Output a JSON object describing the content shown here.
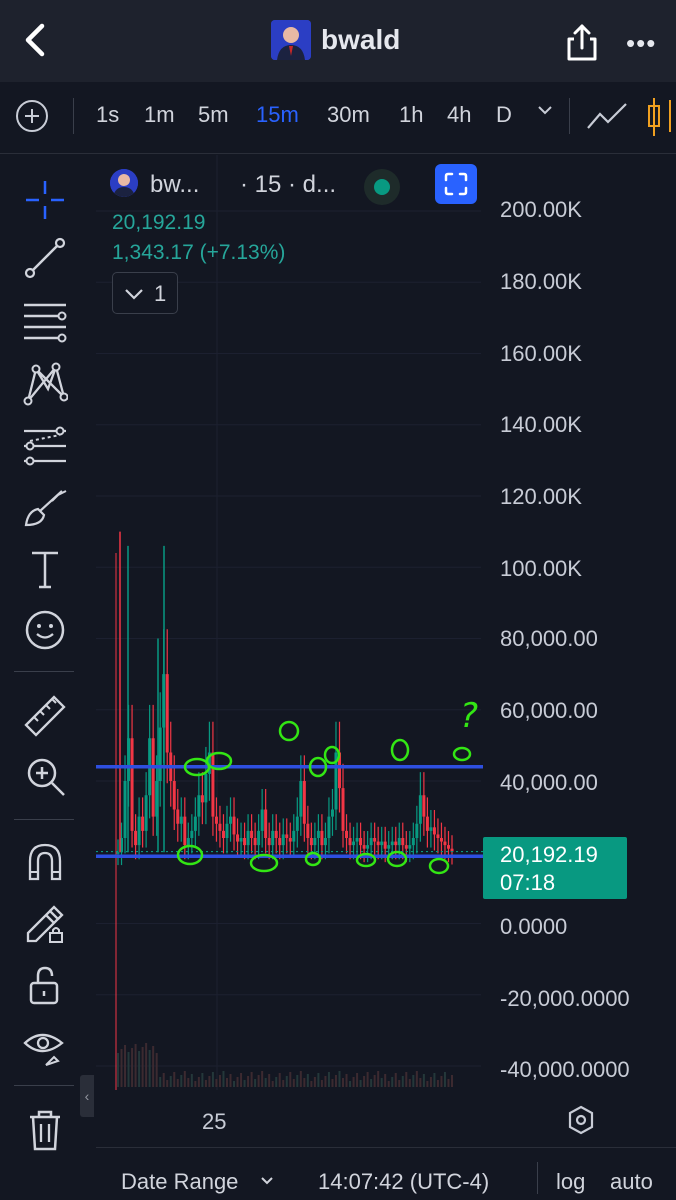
{
  "header": {
    "title": "bwald",
    "back_icon": "chevron-left-icon",
    "share_icon": "share-icon",
    "more_label": "•••"
  },
  "intervals": [
    {
      "label": "1s",
      "active": false
    },
    {
      "label": "1m",
      "active": false
    },
    {
      "label": "5m",
      "active": false
    },
    {
      "label": "15m",
      "active": true
    },
    {
      "label": "30m",
      "active": false
    },
    {
      "label": "1h",
      "active": false
    },
    {
      "label": "4h",
      "active": false
    },
    {
      "label": "D",
      "active": false
    }
  ],
  "interval_dropdown": "⌄",
  "toolbar_icons": [
    "crosshair-icon",
    "trend-line-icon",
    "fib-lines-icon",
    "pattern-icon",
    "projection-icon",
    "brush-icon",
    "text-icon",
    "emoji-icon",
    "ruler-icon",
    "zoom-in-icon",
    "magnet-icon",
    "lock-draw-icon",
    "unlock-icon",
    "eye-icon",
    "trash-icon"
  ],
  "legend": {
    "symbol": "bw...",
    "resolution": "· 15 · d...",
    "price": "20,192.19",
    "change": "1,343.17 (+7.13%)",
    "layer_count": "1"
  },
  "yaxis_labels": [
    "200.00K",
    "180.00K",
    "160.00K",
    "140.00K",
    "120.00K",
    "100.00K",
    "80,000.00",
    "60,000.00",
    "40,000.00",
    "0.0000",
    "-20,000.0000",
    "-40,000.0000"
  ],
  "price_tag": {
    "price": "20,192.19",
    "countdown": "07:18"
  },
  "xaxis_labels": [
    "25"
  ],
  "annotation_question": "?",
  "bottombar": {
    "date_range": "Date Range",
    "time": "14:07:42 (UTC-4)",
    "log": "log",
    "auto": "auto"
  },
  "colors": {
    "accent": "#2962ff",
    "up": "#089981",
    "down": "#f23645",
    "hline": "#2e4fe0",
    "annotation": "#33e614"
  },
  "chart_data": {
    "type": "candlestick",
    "yaxis_ticks": [
      200000,
      180000,
      160000,
      140000,
      120000,
      100000,
      80000,
      60000,
      40000,
      0,
      -20000,
      -40000
    ],
    "ylim": [
      -50000,
      212000
    ],
    "last_price": 20192.19,
    "horizontal_lines": [
      44000,
      20000
    ],
    "close": [
      20000,
      24000,
      40000,
      52000,
      26000,
      22000,
      30000,
      26000,
      36000,
      52000,
      30000,
      40000,
      55000,
      70000,
      48000,
      40000,
      32000,
      28000,
      30000,
      22000,
      24000,
      26000,
      30000,
      36000,
      34000,
      42000,
      48000,
      30000,
      28000,
      26000,
      24000,
      28000,
      30000,
      25000,
      23000,
      24000,
      22000,
      26000,
      24000,
      22000,
      26000,
      32000,
      24000,
      22000,
      26000,
      24000,
      22000,
      25000,
      24000,
      23000,
      26000,
      30000,
      40000,
      28000,
      24000,
      22000,
      24000,
      26000,
      22000,
      24000,
      30000,
      32000,
      48000,
      38000,
      26000,
      24000,
      22000,
      23000,
      24000,
      22000,
      21000,
      22000,
      24000,
      23000,
      22000,
      23000,
      21000,
      22000,
      23000,
      22000,
      24000,
      22000,
      21000,
      22000,
      24000,
      28000,
      36000,
      30000,
      26000,
      27000,
      25000,
      24000,
      23000,
      22000,
      21000,
      20192
    ]
  }
}
